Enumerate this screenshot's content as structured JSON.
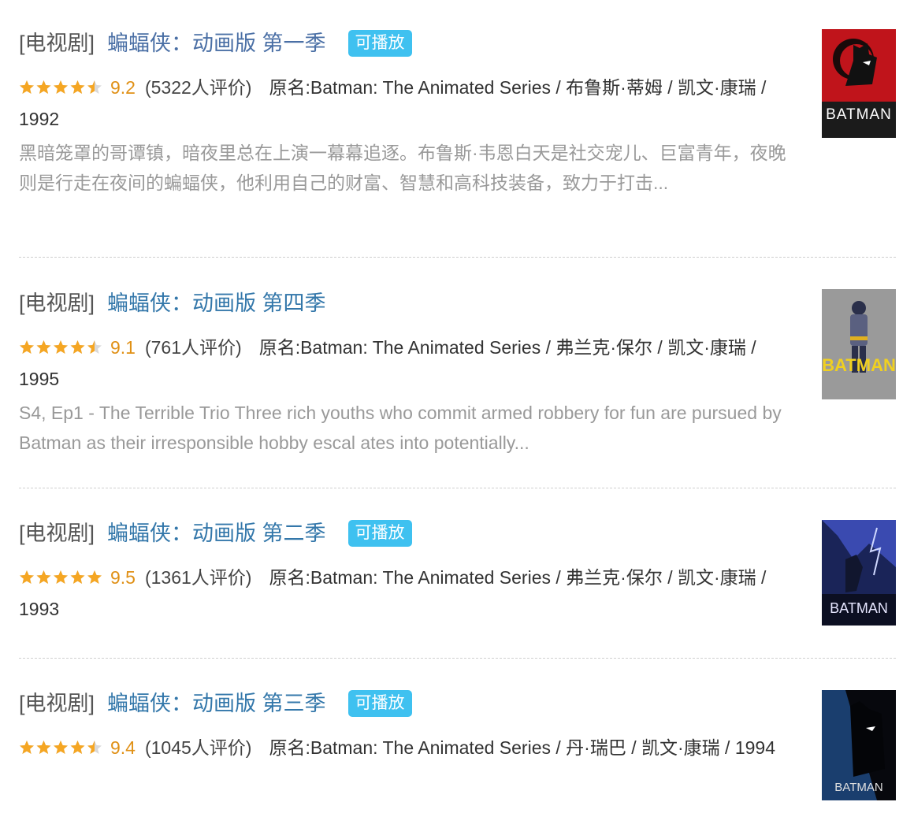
{
  "items": [
    {
      "category": "[电视剧]",
      "title": "蝙蝠侠：动画版 第一季",
      "playable": "可播放",
      "rating": "9.2",
      "stars": 4.5,
      "count": "(5322人评价)",
      "meta": "原名:Batman: The Animated Series / 布鲁斯·蒂姆 / 凯文·康瑞 / 1992",
      "desc": "黑暗笼罩的哥谭镇，暗夜里总在上演一幕幕追逐。布鲁斯·韦恩白天是社交宠儿、巨富青年，夜晚则是行走在夜间的蝙蝠侠，他利用自己的财富、智慧和高科技装备，致力于打击...",
      "poster_text": "BATMAN"
    },
    {
      "category": "[电视剧]",
      "title": "蝙蝠侠：动画版 第四季",
      "playable": "",
      "rating": "9.1",
      "stars": 4.5,
      "count": "(761人评价)",
      "meta": "原名:Batman: The Animated Series / 弗兰克·保尔 / 凯文·康瑞 / 1995",
      "desc": "S4, Ep1 - The Terrible Trio Three rich youths who commit armed robbery for fun are pursued by Batman as their irresponsible hobby escal ates into potentially...",
      "poster_text": "BATMAN"
    },
    {
      "category": "[电视剧]",
      "title": "蝙蝠侠：动画版 第二季",
      "playable": "可播放",
      "rating": "9.5",
      "stars": 5,
      "count": "(1361人评价)",
      "meta": "原名:Batman: The Animated Series / 弗兰克·保尔 / 凯文·康瑞 / 1993",
      "desc": "",
      "poster_text": "BATMAN"
    },
    {
      "category": "[电视剧]",
      "title": "蝙蝠侠：动画版 第三季",
      "playable": "可播放",
      "rating": "9.4",
      "stars": 4.5,
      "count": "(1045人评价)",
      "meta": "原名:Batman: The Animated Series / 丹·瑞巴 / 凯文·康瑞 / 1994",
      "desc": "",
      "poster_text": "BATMAN"
    }
  ],
  "colors": {
    "title": "#3377aa",
    "rating": "#e09015",
    "star": "#f5a623",
    "playable": "#3fc1f0"
  }
}
